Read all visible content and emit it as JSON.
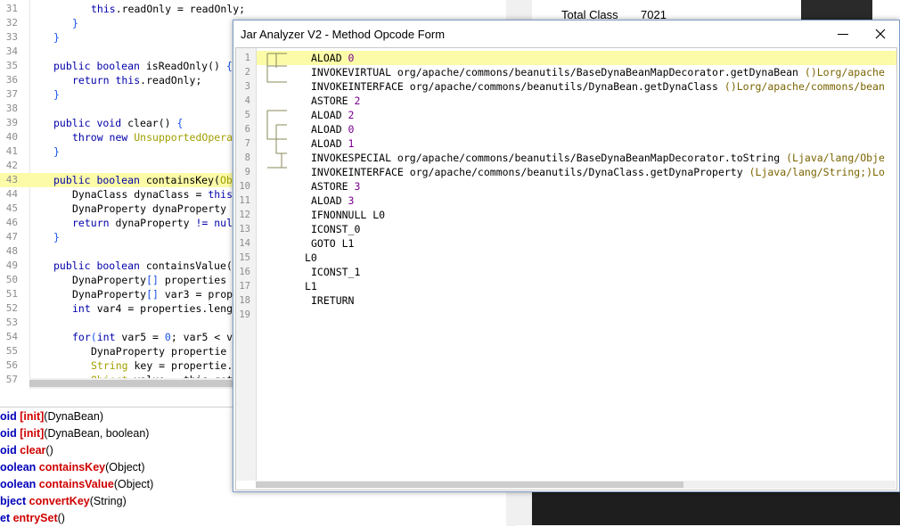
{
  "background_editor": {
    "lines": [
      {
        "num": "31",
        "indent": 3,
        "parts": [
          {
            "t": "this",
            "c": "kw"
          },
          {
            "t": ".readOnly = readOnly;",
            "c": ""
          }
        ]
      },
      {
        "num": "32",
        "indent": 2,
        "parts": [
          {
            "t": "}",
            "c": "op"
          }
        ]
      },
      {
        "num": "33",
        "indent": 1,
        "parts": [
          {
            "t": "}",
            "c": "op"
          }
        ]
      },
      {
        "num": "34",
        "indent": 0,
        "parts": []
      },
      {
        "num": "35",
        "indent": 1,
        "parts": [
          {
            "t": "public boolean ",
            "c": "kw"
          },
          {
            "t": "isReadOnly() ",
            "c": ""
          },
          {
            "t": "{",
            "c": "op"
          }
        ]
      },
      {
        "num": "36",
        "indent": 2,
        "parts": [
          {
            "t": "return this",
            "c": "kw"
          },
          {
            "t": ".readOnly;",
            "c": ""
          }
        ]
      },
      {
        "num": "37",
        "indent": 1,
        "parts": [
          {
            "t": "}",
            "c": "op"
          }
        ]
      },
      {
        "num": "38",
        "indent": 0,
        "parts": []
      },
      {
        "num": "39",
        "indent": 1,
        "parts": [
          {
            "t": "public void ",
            "c": "kw"
          },
          {
            "t": "clear() ",
            "c": ""
          },
          {
            "t": "{",
            "c": "op"
          }
        ]
      },
      {
        "num": "40",
        "indent": 2,
        "parts": [
          {
            "t": "throw new ",
            "c": "kw"
          },
          {
            "t": "UnsupportedOpera",
            "c": "ty"
          }
        ]
      },
      {
        "num": "41",
        "indent": 1,
        "parts": [
          {
            "t": "}",
            "c": "op"
          }
        ]
      },
      {
        "num": "42",
        "indent": 0,
        "parts": []
      },
      {
        "num": "43",
        "indent": 1,
        "hl": true,
        "parts": [
          {
            "t": "public boolean ",
            "c": "kw"
          },
          {
            "t": "containsKey(",
            "c": ""
          },
          {
            "t": "Ob",
            "c": "ty"
          }
        ]
      },
      {
        "num": "44",
        "indent": 2,
        "parts": [
          {
            "t": "DynaClass dynaClass = ",
            "c": ""
          },
          {
            "t": "this",
            "c": "kw"
          }
        ]
      },
      {
        "num": "45",
        "indent": 2,
        "parts": [
          {
            "t": "DynaProperty dynaProperty",
            "c": ""
          }
        ]
      },
      {
        "num": "46",
        "indent": 2,
        "parts": [
          {
            "t": "return ",
            "c": "kw"
          },
          {
            "t": "dynaProperty ",
            "c": ""
          },
          {
            "t": "!= nul",
            "c": "kw"
          }
        ]
      },
      {
        "num": "47",
        "indent": 1,
        "parts": [
          {
            "t": "}",
            "c": "op"
          }
        ]
      },
      {
        "num": "48",
        "indent": 0,
        "parts": []
      },
      {
        "num": "49",
        "indent": 1,
        "parts": [
          {
            "t": "public boolean ",
            "c": "kw"
          },
          {
            "t": "containsValue(",
            "c": ""
          }
        ]
      },
      {
        "num": "50",
        "indent": 2,
        "parts": [
          {
            "t": "DynaProperty",
            "c": ""
          },
          {
            "t": "[]",
            "c": "op"
          },
          {
            "t": " properties",
            "c": ""
          }
        ]
      },
      {
        "num": "51",
        "indent": 2,
        "parts": [
          {
            "t": "DynaProperty",
            "c": ""
          },
          {
            "t": "[]",
            "c": "op"
          },
          {
            "t": " var3 = prop",
            "c": ""
          }
        ]
      },
      {
        "num": "52",
        "indent": 2,
        "parts": [
          {
            "t": "int ",
            "c": "kw"
          },
          {
            "t": "var4 = properties.leng",
            "c": ""
          }
        ]
      },
      {
        "num": "53",
        "indent": 0,
        "parts": []
      },
      {
        "num": "54",
        "indent": 2,
        "parts": [
          {
            "t": "for",
            "c": "kw"
          },
          {
            "t": "(",
            "c": "op"
          },
          {
            "t": "int ",
            "c": "kw"
          },
          {
            "t": "var5 = ",
            "c": ""
          },
          {
            "t": "0",
            "c": "nu"
          },
          {
            "t": "; var5 < v",
            "c": ""
          }
        ]
      },
      {
        "num": "55",
        "indent": 3,
        "parts": [
          {
            "t": "DynaProperty propertie",
            "c": ""
          }
        ]
      },
      {
        "num": "56",
        "indent": 3,
        "parts": [
          {
            "t": "String ",
            "c": "ty"
          },
          {
            "t": "key = propertie.",
            "c": ""
          }
        ]
      },
      {
        "num": "57",
        "indent": 3,
        "parts": [
          {
            "t": "Object ",
            "c": "ty"
          },
          {
            "t": "value = this.get(",
            "c": ""
          }
        ]
      }
    ]
  },
  "method_list": [
    {
      "ret": "oid",
      "name": "[init]",
      "args": "(DynaBean)"
    },
    {
      "ret": "oid",
      "name": "[init]",
      "args": "(DynaBean, boolean)"
    },
    {
      "ret": "oid",
      "name": "clear",
      "args": "()"
    },
    {
      "ret": "oolean",
      "name": "containsKey",
      "args": "(Object)"
    },
    {
      "ret": "oolean",
      "name": "containsValue",
      "args": "(Object)"
    },
    {
      "ret": "bject",
      "name": "convertKey",
      "args": "(String)"
    },
    {
      "ret": "et",
      "name": "entrySet",
      "args": "()"
    }
  ],
  "right_panel": {
    "total_class_label": "Total Class",
    "total_class_value": "7021"
  },
  "dialog": {
    "title": "Jar Analyzer V2 - Method Opcode Form",
    "minimize_icon": "minimize-icon",
    "close_icon": "close-icon",
    "opcode_lines": [
      {
        "num": "1",
        "hl": true,
        "parts": [
          {
            "t": "ALOAD ",
            "c": ""
          },
          {
            "t": "0",
            "c": "opnum"
          }
        ]
      },
      {
        "num": "2",
        "parts": [
          {
            "t": "INVOKEVIRTUAL org/apache/commons/beanutils/BaseDynaBeanMapDecorator.getDynaBean ",
            "c": ""
          },
          {
            "t": "()Lorg/apache",
            "c": "ostr"
          }
        ]
      },
      {
        "num": "3",
        "parts": [
          {
            "t": "INVOKEINTERFACE org/apache/commons/beanutils/DynaBean.getDynaClass ",
            "c": ""
          },
          {
            "t": "()Lorg/apache/commons/bean",
            "c": "ostr"
          }
        ]
      },
      {
        "num": "4",
        "parts": [
          {
            "t": "ASTORE ",
            "c": ""
          },
          {
            "t": "2",
            "c": "opnum"
          }
        ]
      },
      {
        "num": "5",
        "parts": [
          {
            "t": "ALOAD ",
            "c": ""
          },
          {
            "t": "2",
            "c": "opnum"
          }
        ]
      },
      {
        "num": "6",
        "parts": [
          {
            "t": "ALOAD ",
            "c": ""
          },
          {
            "t": "0",
            "c": "opnum"
          }
        ]
      },
      {
        "num": "7",
        "parts": [
          {
            "t": "ALOAD ",
            "c": ""
          },
          {
            "t": "1",
            "c": "opnum"
          }
        ]
      },
      {
        "num": "8",
        "parts": [
          {
            "t": "INVOKESPECIAL org/apache/commons/beanutils/BaseDynaBeanMapDecorator.toString ",
            "c": ""
          },
          {
            "t": "(Ljava/lang/Obje",
            "c": "ostr"
          }
        ]
      },
      {
        "num": "9",
        "parts": [
          {
            "t": "INVOKEINTERFACE org/apache/commons/beanutils/DynaClass.getDynaProperty ",
            "c": ""
          },
          {
            "t": "(Ljava/lang/String;)Lo",
            "c": "ostr"
          }
        ]
      },
      {
        "num": "10",
        "parts": [
          {
            "t": "ASTORE ",
            "c": ""
          },
          {
            "t": "3",
            "c": "opnum"
          }
        ]
      },
      {
        "num": "11",
        "parts": [
          {
            "t": "ALOAD ",
            "c": ""
          },
          {
            "t": "3",
            "c": "opnum"
          }
        ]
      },
      {
        "num": "12",
        "parts": [
          {
            "t": "IFNONNULL L0",
            "c": ""
          }
        ]
      },
      {
        "num": "13",
        "parts": [
          {
            "t": "ICONST_0",
            "c": ""
          }
        ]
      },
      {
        "num": "14",
        "parts": [
          {
            "t": "GOTO L1",
            "c": ""
          }
        ]
      },
      {
        "num": "15",
        "label": true,
        "parts": [
          {
            "t": "L0",
            "c": ""
          }
        ]
      },
      {
        "num": "16",
        "parts": [
          {
            "t": "ICONST_1",
            "c": ""
          }
        ]
      },
      {
        "num": "17",
        "label": true,
        "parts": [
          {
            "t": "L1",
            "c": ""
          }
        ]
      },
      {
        "num": "18",
        "parts": [
          {
            "t": "IRETURN",
            "c": ""
          }
        ]
      },
      {
        "num": "19",
        "parts": []
      }
    ]
  },
  "colors": {
    "keyword": "#0000aa",
    "highlight": "#fbfba8",
    "method_name": "#d00000",
    "return_type": "#0000bb"
  }
}
